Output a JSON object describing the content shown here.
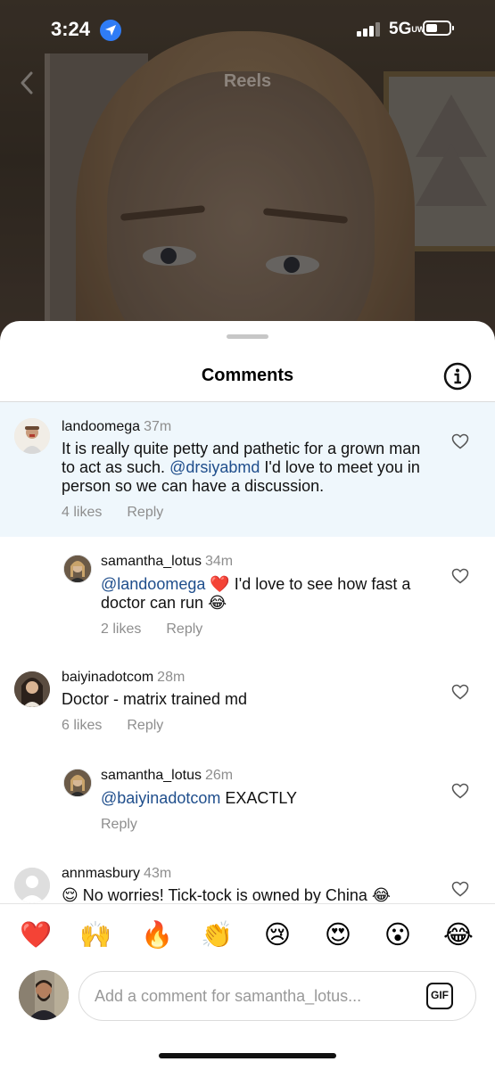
{
  "status_bar": {
    "time": "3:24",
    "network": "5G",
    "network_suffix": "UW"
  },
  "header": {
    "title": "Reels"
  },
  "sheet": {
    "title": "Comments"
  },
  "comments": [
    {
      "username": "landoomega",
      "time": "37m",
      "text_part1": "It is really quite petty and pathetic for a grown man to act as such. ",
      "mention": "@drsiyabmd",
      "text_part2": " I'd love to meet you in person so we can have a discussion.",
      "likes": "4 likes",
      "reply": "Reply"
    },
    {
      "username": "samantha_lotus",
      "time": "34m",
      "mention": "@landoomega",
      "text_part1": "❤️",
      "text_part2": " I'd love to see how fast a doctor can run 😂",
      "likes": "2 likes",
      "reply": "Reply"
    },
    {
      "username": "baiyinadotcom",
      "time": "28m",
      "text_part1": "Doctor - matrix trained md",
      "likes": "6 likes",
      "reply": "Reply"
    },
    {
      "username": "samantha_lotus",
      "time": "26m",
      "mention": "@baiyinadotcom",
      "text_part1": " EXACTLY",
      "reply": "Reply"
    },
    {
      "username": "annmasbury",
      "time": "43m",
      "text_part1": "😌 No worries! Tick-tock is owned by China 😂"
    }
  ],
  "emoji_bar": [
    "❤️",
    "🙌",
    "🔥",
    "👏",
    "😢",
    "😍",
    "😮",
    "😂"
  ],
  "composer": {
    "placeholder": "Add a comment for samantha_lotus...",
    "gif_label": "GIF"
  },
  "colors": {
    "mention": "#1f4e8c",
    "highlight": "#eff7fc",
    "meta": "#8e8e8e"
  }
}
